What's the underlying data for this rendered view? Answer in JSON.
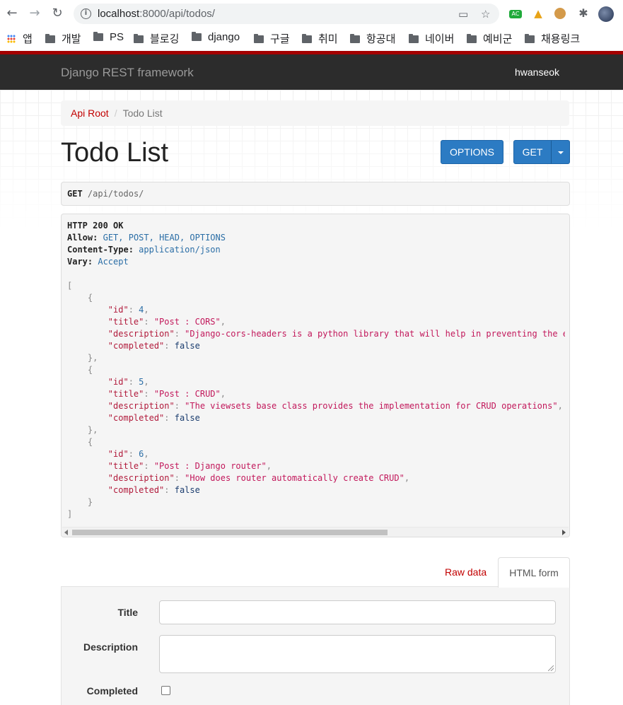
{
  "browser": {
    "url_host": "localhost",
    "url_rest": ":8000/api/todos/",
    "bookmarks": [
      "앱",
      "개발",
      "PS",
      "블로깅",
      "django",
      "구글",
      "취미",
      "항공대",
      "네이버",
      "예비군",
      "채용링크"
    ],
    "ext_ac_label": "AC"
  },
  "navbar": {
    "brand": "Django REST framework",
    "user": "hwanseok"
  },
  "breadcrumb": {
    "root": "Api Root",
    "separator": "/",
    "current": "Todo List"
  },
  "page": {
    "title": "Todo List",
    "options_label": "OPTIONS",
    "get_label": "GET"
  },
  "request": {
    "method": "GET",
    "path": "/api/todos/"
  },
  "response": {
    "status": "HTTP 200 OK",
    "headers": [
      {
        "name": "Allow:",
        "value": "GET, POST, HEAD, OPTIONS"
      },
      {
        "name": "Content-Type:",
        "value": "application/json"
      },
      {
        "name": "Vary:",
        "value": "Accept"
      }
    ],
    "todos": [
      {
        "id": "4",
        "title": "\"Post : CORS\"",
        "description": "\"Django-cors-headers is a python library that will help in preventing the errors that you would normally get due to CORS rules.\"",
        "completed": "false"
      },
      {
        "id": "5",
        "title": "\"Post : CRUD\"",
        "description": "\"The viewsets base class provides the implementation for CRUD operations\"",
        "completed": "false"
      },
      {
        "id": "6",
        "title": "\"Post : Django router\"",
        "description": "\"How does router automatically create CRUD\"",
        "completed": "false"
      }
    ]
  },
  "form": {
    "tab_raw": "Raw data",
    "tab_html": "HTML form",
    "label_title": "Title",
    "label_description": "Description",
    "label_completed": "Completed"
  },
  "colors": {
    "brand_red": "#a30000",
    "link_red": "#c20000",
    "button_blue": "#2c7bc3",
    "navbar_dark": "#2c2c2c"
  }
}
